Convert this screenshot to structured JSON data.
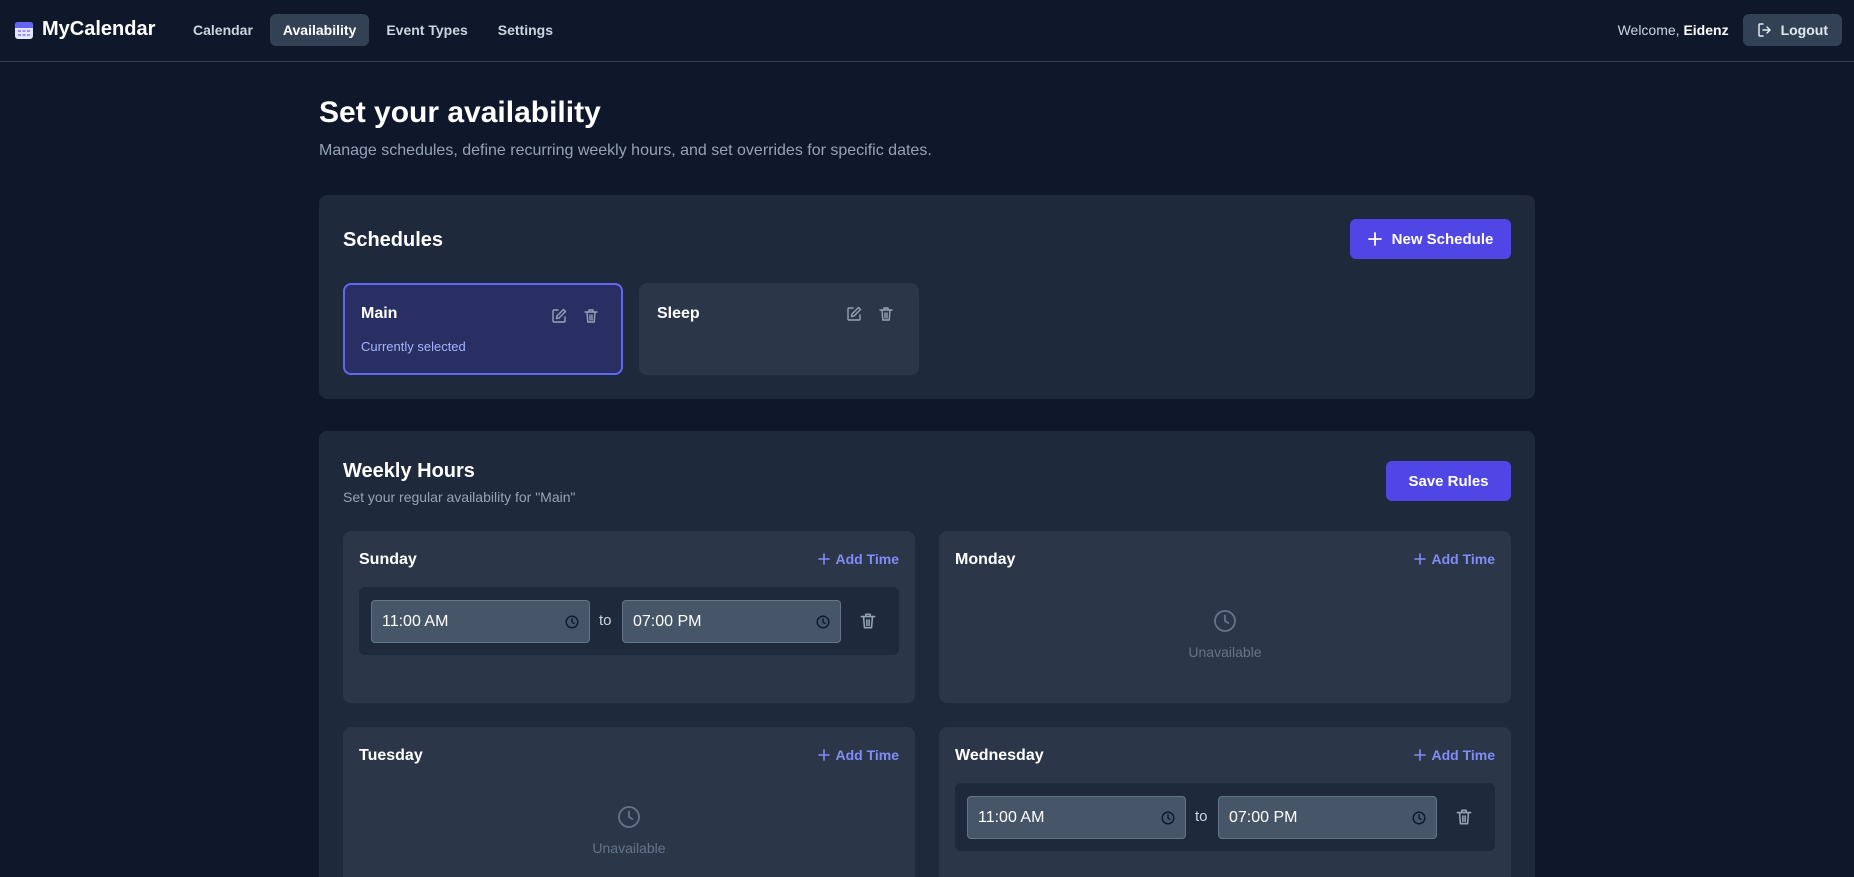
{
  "nav": {
    "brand": "MyCalendar",
    "links": [
      "Calendar",
      "Availability",
      "Event Types",
      "Settings"
    ],
    "welcome_prefix": "Welcome,",
    "username": "Eidenz",
    "logout": "Logout"
  },
  "header": {
    "title": "Set your availability",
    "subtitle": "Manage schedules, define recurring weekly hours, and set overrides for specific dates."
  },
  "schedules": {
    "title": "Schedules",
    "new_button": "New Schedule",
    "items": [
      {
        "name": "Main",
        "status": "Currently selected"
      },
      {
        "name": "Sleep"
      }
    ]
  },
  "weekly": {
    "title": "Weekly Hours",
    "subtitle": "Set your regular availability for \"Main\"",
    "save_button": "Save Rules",
    "add_time": "Add Time",
    "to": "to",
    "unavailable": "Unavailable",
    "days": [
      {
        "name": "Sunday",
        "start": "11:00 AM",
        "end": "07:00 PM"
      },
      {
        "name": "Monday"
      },
      {
        "name": "Tuesday"
      },
      {
        "name": "Wednesday",
        "start": "11:00 AM",
        "end": "07:00 PM"
      }
    ]
  },
  "colors": {
    "background": "#0f172a",
    "card": "#1e293b",
    "accent": "#4f46e5",
    "accent_text": "#818cf8"
  }
}
